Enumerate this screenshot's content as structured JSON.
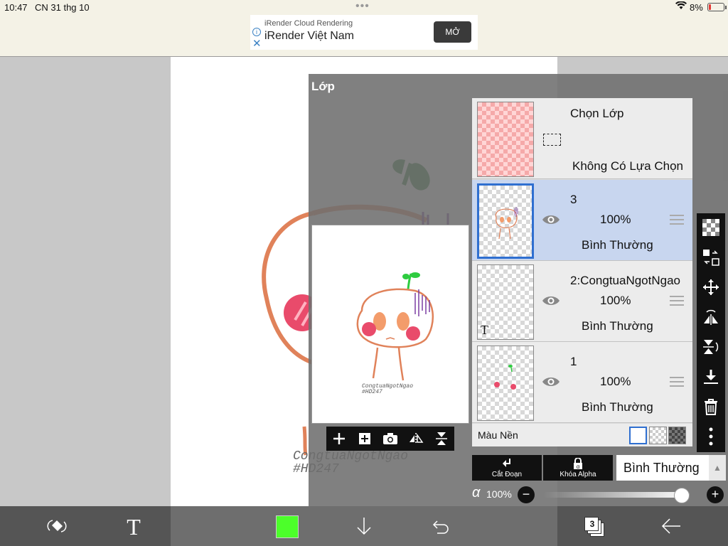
{
  "status_bar": {
    "time": "10:47",
    "date": "CN 31 thg 10",
    "battery": "8%"
  },
  "ad": {
    "subtitle": "iRender Cloud Rendering",
    "title": "iRender Việt Nam",
    "open_label": "MỞ"
  },
  "canvas": {
    "watermark_line1": "CongtuaNgotNgao",
    "watermark_line2": "#HD247"
  },
  "layer_panel": {
    "title": "Lớp",
    "selection_row": {
      "title": "Chọn Lớp",
      "subtitle": "Không Có Lựa Chọn"
    },
    "layers": [
      {
        "name": "3",
        "opacity": "100%",
        "blend": "Bình Thường",
        "selected": true
      },
      {
        "name": "2:CongtuaNgotNgao",
        "opacity": "100%",
        "blend": "Bình Thường",
        "selected": false
      },
      {
        "name": "1",
        "opacity": "100%",
        "blend": "Bình Thường",
        "selected": false
      }
    ],
    "background_label": "Màu Nền",
    "clip_label": "Cắt Đoạn",
    "alpha_lock_label": "Khóa Alpha",
    "blend_mode": "Bình Thường",
    "alpha_symbol": "α",
    "alpha_value": "100%",
    "alpha_fraction": 1.0,
    "thumb_text_marker": "T"
  },
  "bottom_bar": {
    "current_color": "#4cff2a",
    "layer_count": "3"
  },
  "colors": {
    "selection_blue": "#2f6fd0",
    "selected_row": "#c8d6ef",
    "panel_bg": "#6e6e6e"
  }
}
